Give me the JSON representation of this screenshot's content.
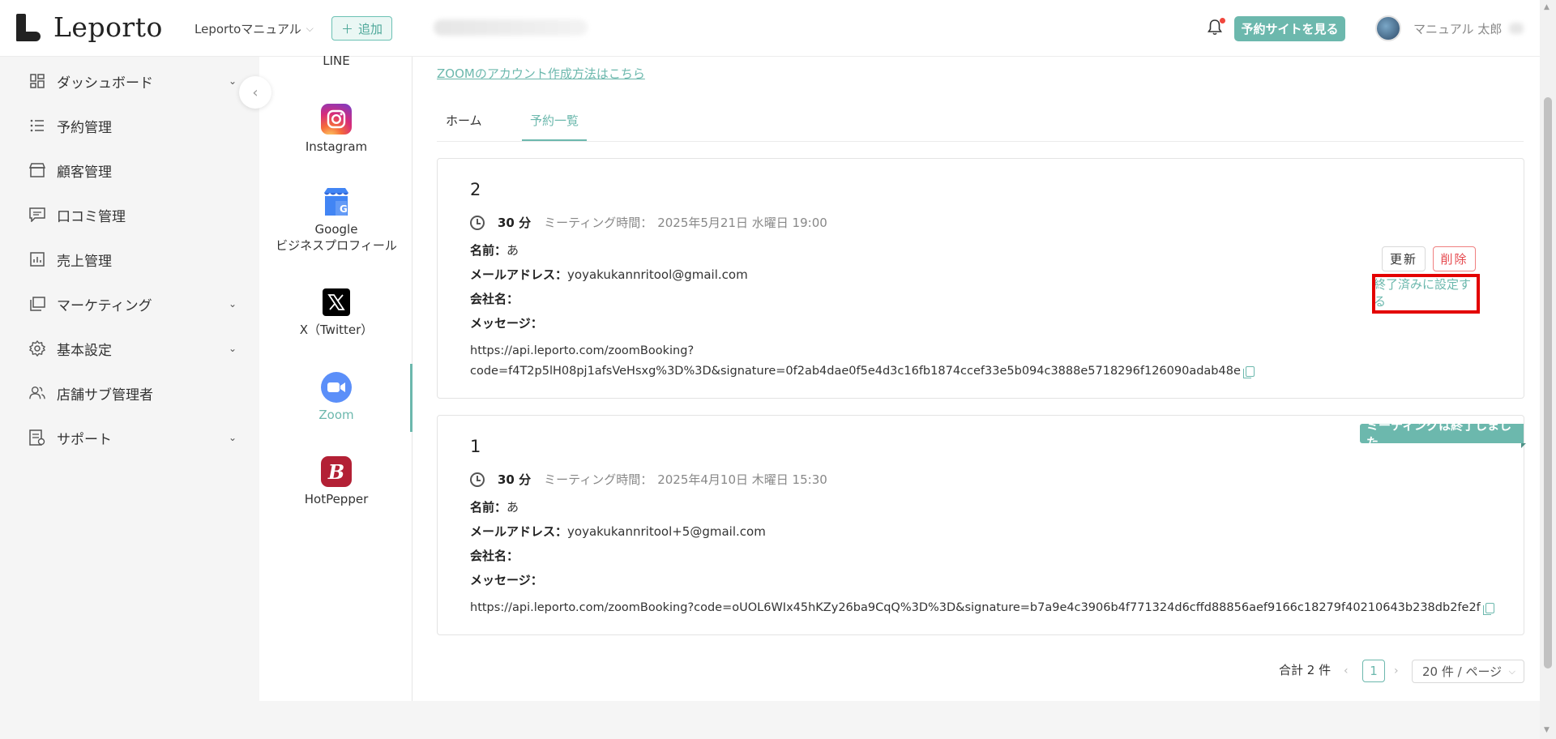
{
  "header": {
    "logo_text": "Leporto",
    "org_select": "Leportoマニュアル",
    "add_button": "追加",
    "view_site_button": "予約サイトを見る",
    "user_name": "マニュアル 太郎"
  },
  "sidebar": {
    "items": [
      {
        "label": "ダッシュボード",
        "icon": "dashboard-icon",
        "has_chevron": true
      },
      {
        "label": "予約管理",
        "icon": "list-icon",
        "has_chevron": false
      },
      {
        "label": "顧客管理",
        "icon": "store-icon",
        "has_chevron": false
      },
      {
        "label": "口コミ管理",
        "icon": "comment-icon",
        "has_chevron": false
      },
      {
        "label": "売上管理",
        "icon": "chart-icon",
        "has_chevron": false
      },
      {
        "label": "マーケティング",
        "icon": "copy-icon",
        "has_chevron": true
      },
      {
        "label": "基本設定",
        "icon": "gear-icon",
        "has_chevron": true
      },
      {
        "label": "店舗サブ管理者",
        "icon": "users-icon",
        "has_chevron": false
      },
      {
        "label": "サポート",
        "icon": "document-icon",
        "has_chevron": true
      }
    ]
  },
  "integrations": {
    "items": [
      {
        "label": "LINE"
      },
      {
        "label": "Instagram"
      },
      {
        "label": "Google",
        "label2": "ビジネスプロフィール"
      },
      {
        "label": "X（Twitter）"
      },
      {
        "label": "Zoom",
        "active": true
      },
      {
        "label": "HotPepper"
      }
    ]
  },
  "main": {
    "zoom_link": "ZOOMのアカウント作成方法はこちら",
    "tabs": [
      {
        "label": "ホーム",
        "active": false
      },
      {
        "label": "予約一覧",
        "active": true
      }
    ],
    "labels": {
      "duration": "30 分",
      "meeting_time_label": "ミーティング時間：",
      "name_label": "名前：",
      "email_label": "メールアドレス：",
      "company_label": "会社名：",
      "message_label": "メッセージ："
    },
    "bookings": [
      {
        "number": "2",
        "meeting_time": "2025年5月21日 水曜日 19:00",
        "name": "あ",
        "email": "yoyakukannritool@gmail.com",
        "company": "",
        "message": "",
        "url_line1": "https://api.leporto.com/zoomBooking?",
        "url_line2": "code=f4T2p5lH08pj1afsVeHsxg%3D%3D&signature=0f2ab4dae0f5e4d3c16fb1874ccef33e5b094c3888e5718296f126090adab48e",
        "update_button": "更新",
        "delete_button": "削除",
        "finish_button": "終了済みに設定する"
      },
      {
        "number": "1",
        "meeting_time": "2025年4月10日 木曜日 15:30",
        "name": "あ",
        "email": "yoyakukannritool+5@gmail.com",
        "company": "",
        "message": "",
        "url": "https://api.leporto.com/zoomBooking?code=oUOL6WIx45hKZy26ba9CqQ%3D%3D&signature=b7a9e4c3906b4f771324d6cffd88856aef9166c18279f40210643b238db2fe2f",
        "ended_badge": "ミーティングは終了しました"
      }
    ]
  },
  "pagination": {
    "total": "合計 2 件",
    "current_page": "1",
    "page_size": "20 件 / ページ"
  },
  "colors": {
    "accent": "#6cb8ad",
    "danger": "#e5484d",
    "highlight": "#e30000"
  }
}
